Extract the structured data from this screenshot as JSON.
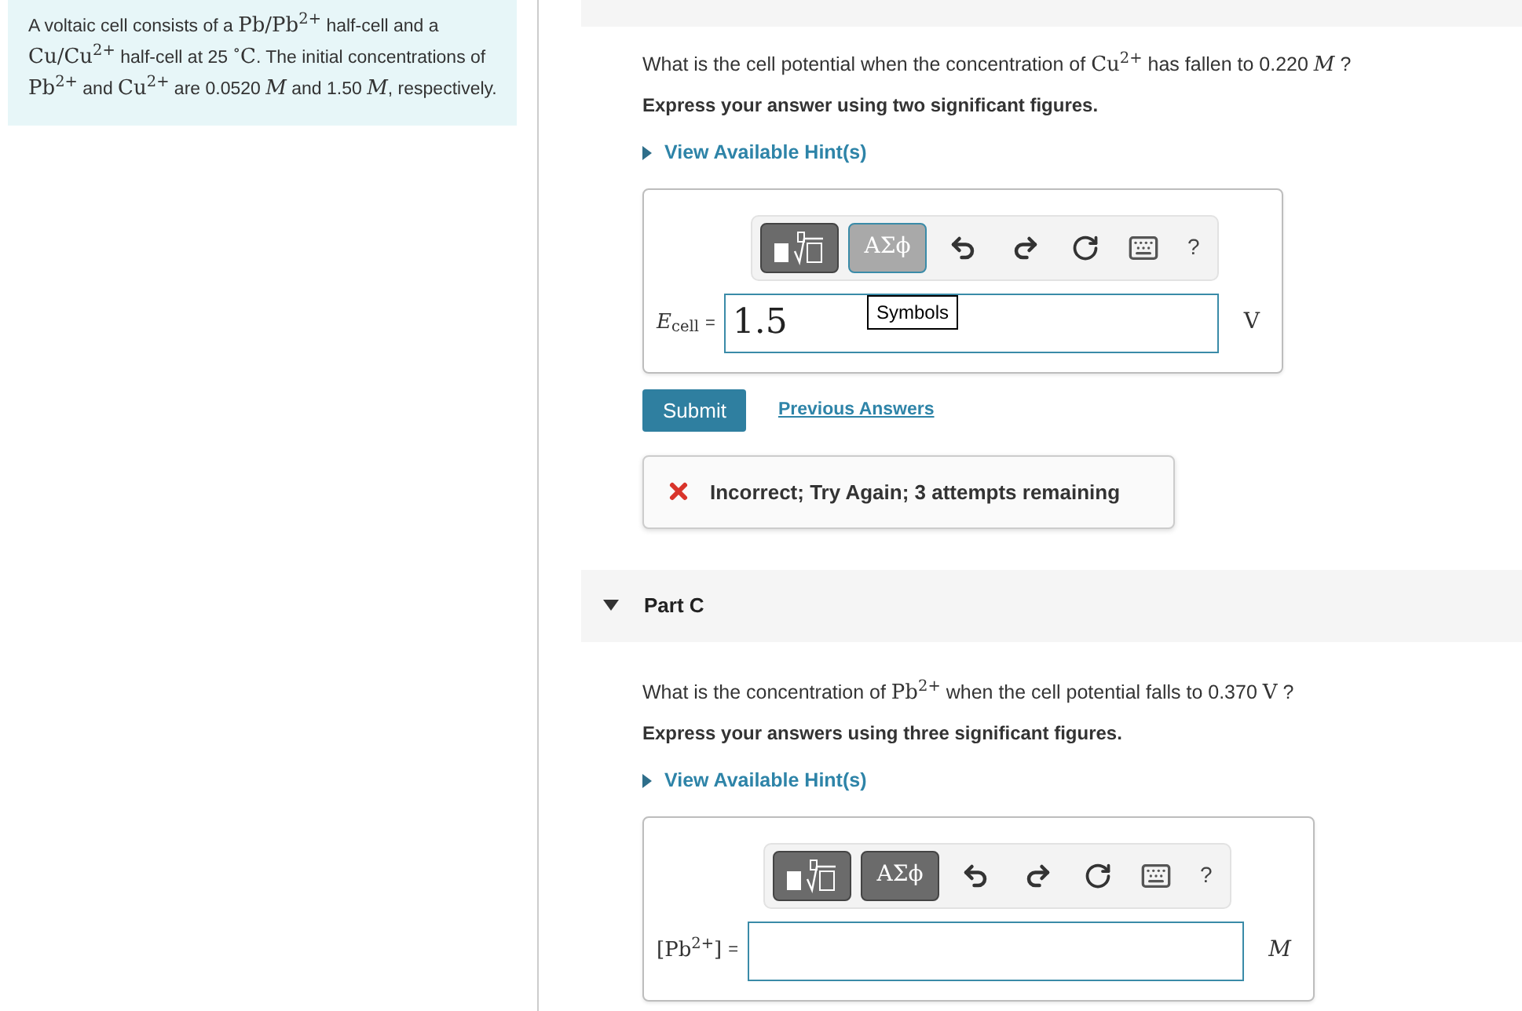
{
  "intro": [
    {
      "kind": "text",
      "text": "A voltaic cell consists of a "
    },
    {
      "kind": "math",
      "text": "Pb/Pb$^{2+}$"
    },
    {
      "kind": "text",
      "text": " half-cell and a "
    },
    {
      "kind": "math",
      "text": "Cu/Cu$^{2+}$"
    },
    {
      "kind": "text",
      "text": " half-cell at 25 "
    },
    {
      "kind": "math",
      "text": "$^{∘}$C"
    },
    {
      "kind": "text",
      "text": ". The initial concentrations of "
    },
    {
      "kind": "math",
      "text": "Pb$^{2+}$"
    },
    {
      "kind": "text",
      "text": " and "
    },
    {
      "kind": "math",
      "text": "Cu$^{2+}$"
    },
    {
      "kind": "text",
      "text": " are 0.0520 "
    },
    {
      "kind": "math",
      "text": "*M*"
    },
    {
      "kind": "text",
      "text": " and 1.50 "
    },
    {
      "kind": "math",
      "text": "*M*"
    },
    {
      "kind": "text",
      "text": ", respectively."
    }
  ],
  "parts": [
    {
      "question": [
        {
          "kind": "text",
          "text": "What is the cell potential when the concentration of "
        },
        {
          "kind": "math",
          "text": "Cu$^{2+}$"
        },
        {
          "kind": "text",
          "text": " has fallen to 0.220 "
        },
        {
          "kind": "math",
          "text": "*M*"
        },
        {
          "kind": "text",
          "text": " ?"
        }
      ],
      "instruction": "Express your answer using two significant figures.",
      "hint_link": "View Available Hint(s)",
      "toolbar": {
        "symbols_label": "ΑΣϕ",
        "symbols_hovered": true,
        "tooltip": "Symbols",
        "help": "?"
      },
      "answer": {
        "label": "*E*$_{cell}$",
        "equals": "=",
        "value": "1.5",
        "unit": "V",
        "unit_italic": false
      },
      "submit": "Submit",
      "previous_answers": "Previous Answers",
      "feedback": {
        "kind": "incorrect",
        "text": "Incorrect; Try Again; 3 attempts remaining"
      }
    },
    {
      "title": "Part C",
      "expanded": true,
      "question": [
        {
          "kind": "text",
          "text": "What is the concentration of "
        },
        {
          "kind": "math",
          "text": "Pb$^{2+}$"
        },
        {
          "kind": "text",
          "text": " when the cell potential falls to 0.370 "
        },
        {
          "kind": "math",
          "text": "V"
        },
        {
          "kind": "text",
          "text": " ?"
        }
      ],
      "instruction": "Express your answers using three significant figures.",
      "hint_link": "View Available Hint(s)",
      "toolbar": {
        "symbols_label": "ΑΣϕ",
        "symbols_hovered": false,
        "help": "?"
      },
      "answer": {
        "label": "[Pb$^{2+}$]",
        "equals": "=",
        "unit": "M",
        "unit_italic": true
      }
    }
  ]
}
